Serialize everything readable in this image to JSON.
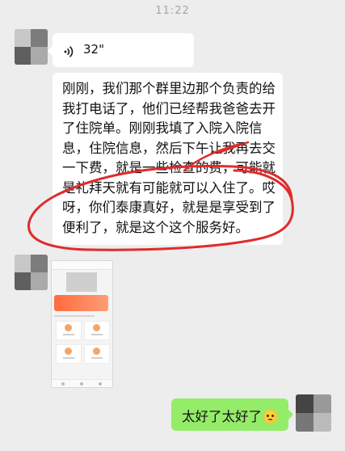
{
  "time": "11:22",
  "voice_message": {
    "duration": "32\""
  },
  "text_message": {
    "text": "刚刚，我们那个群里边那个负责的给我打电话了，他们已经帮我爸爸去开了住院单。刚刚我填了入院入院信息，住院信息，然后下午让我再去交一下费，就是一些检查的费，可能就是礼拜天就有可能就可以入住了。哎呀，你们泰康真好，就是是享受到了便利了，就是这个这个服务好。"
  },
  "my_message": {
    "text": "太好了太好了",
    "emoji": "flushed-face-emoji"
  },
  "colors": {
    "background": "#ededed",
    "incoming_bubble": "#ffffff",
    "outgoing_bubble": "#95ec69",
    "annotation_red": "#e02b2b"
  },
  "icons": {
    "voice": "voice-wave-icon"
  }
}
